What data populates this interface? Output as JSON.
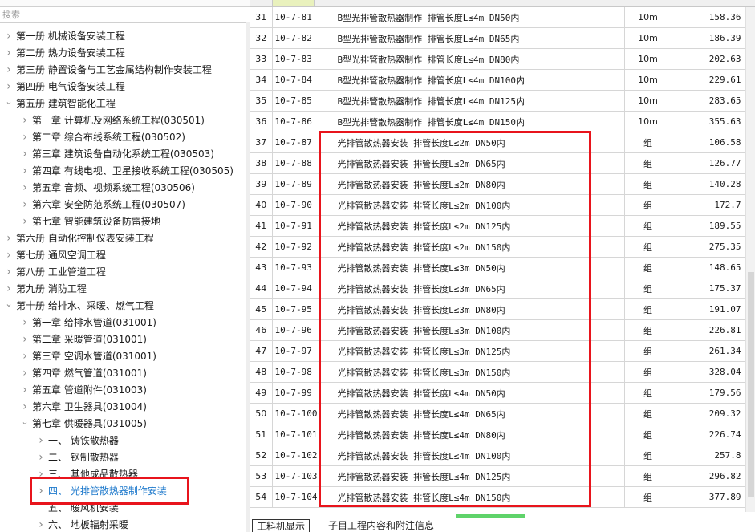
{
  "search_placeholder": "搜索",
  "tree": [
    {
      "level": 0,
      "exp": false,
      "text": "第一册 机械设备安装工程"
    },
    {
      "level": 0,
      "exp": false,
      "text": "第二册 热力设备安装工程"
    },
    {
      "level": 0,
      "exp": false,
      "text": "第三册 静置设备与工艺金属结构制作安装工程"
    },
    {
      "level": 0,
      "exp": false,
      "text": "第四册 电气设备安装工程"
    },
    {
      "level": 0,
      "exp": true,
      "text": "第五册 建筑智能化工程"
    },
    {
      "level": 1,
      "exp": false,
      "text": "第一章 计算机及网络系统工程(030501)"
    },
    {
      "level": 1,
      "exp": false,
      "text": "第二章 综合布线系统工程(030502)"
    },
    {
      "level": 1,
      "exp": false,
      "text": "第三章 建筑设备自动化系统工程(030503)"
    },
    {
      "level": 1,
      "exp": false,
      "text": "第四章 有线电视、卫星接收系统工程(030505)"
    },
    {
      "level": 1,
      "exp": false,
      "text": "第五章 音频、视频系统工程(030506)"
    },
    {
      "level": 1,
      "exp": false,
      "text": "第六章 安全防范系统工程(030507)"
    },
    {
      "level": 1,
      "exp": false,
      "text": "第七章 智能建筑设备防雷接地"
    },
    {
      "level": 0,
      "exp": false,
      "text": "第六册 自动化控制仪表安装工程"
    },
    {
      "level": 0,
      "exp": false,
      "text": "第七册 通风空调工程"
    },
    {
      "level": 0,
      "exp": false,
      "text": "第八册 工业管道工程"
    },
    {
      "level": 0,
      "exp": false,
      "text": "第九册 消防工程"
    },
    {
      "level": 0,
      "exp": true,
      "text": "第十册 给排水、采暖、燃气工程"
    },
    {
      "level": 1,
      "exp": false,
      "text": "第一章 给排水管道(031001)"
    },
    {
      "level": 1,
      "exp": false,
      "text": "第二章 采暖管道(031001)"
    },
    {
      "level": 1,
      "exp": false,
      "text": "第三章 空调水管道(031001)"
    },
    {
      "level": 1,
      "exp": false,
      "text": "第四章 燃气管道(031001)"
    },
    {
      "level": 1,
      "exp": false,
      "text": "第五章 管道附件(031003)"
    },
    {
      "level": 1,
      "exp": false,
      "text": "第六章 卫生器具(031004)"
    },
    {
      "level": 1,
      "exp": true,
      "text": "第七章 供暖器具(031005)"
    },
    {
      "level": 2,
      "exp": false,
      "text": "一、 铸铁散热器"
    },
    {
      "level": 2,
      "exp": false,
      "text": "二、 钢制散热器"
    },
    {
      "level": 2,
      "exp": false,
      "text": "三、 其他成品散热器"
    },
    {
      "level": 2,
      "exp": false,
      "text": "四、 光排管散热器制作安装",
      "selected": true
    },
    {
      "level": 2,
      "exp": null,
      "text": "五、 暖风机安装"
    },
    {
      "level": 2,
      "exp": false,
      "text": "六、 地板辐射采暖"
    }
  ],
  "rows": [
    {
      "no": "31",
      "code": "10-7-81",
      "name": "B型光排管散热器制作 排管长度L≤4m DN50内",
      "unit": "10m",
      "price": "158.36"
    },
    {
      "no": "32",
      "code": "10-7-82",
      "name": "B型光排管散热器制作 排管长度L≤4m DN65内",
      "unit": "10m",
      "price": "186.39"
    },
    {
      "no": "33",
      "code": "10-7-83",
      "name": "B型光排管散热器制作 排管长度L≤4m DN80内",
      "unit": "10m",
      "price": "202.63"
    },
    {
      "no": "34",
      "code": "10-7-84",
      "name": "B型光排管散热器制作 排管长度L≤4m DN100内",
      "unit": "10m",
      "price": "229.61"
    },
    {
      "no": "35",
      "code": "10-7-85",
      "name": "B型光排管散热器制作 排管长度L≤4m DN125内",
      "unit": "10m",
      "price": "283.65"
    },
    {
      "no": "36",
      "code": "10-7-86",
      "name": "B型光排管散热器制作 排管长度L≤4m DN150内",
      "unit": "10m",
      "price": "355.63"
    },
    {
      "no": "37",
      "code": "10-7-87",
      "name": "光排管散热器安装 排管长度L≤2m DN50内",
      "unit": "组",
      "price": "106.58"
    },
    {
      "no": "38",
      "code": "10-7-88",
      "name": "光排管散热器安装 排管长度L≤2m DN65内",
      "unit": "组",
      "price": "126.77"
    },
    {
      "no": "39",
      "code": "10-7-89",
      "name": "光排管散热器安装 排管长度L≤2m DN80内",
      "unit": "组",
      "price": "140.28"
    },
    {
      "no": "40",
      "code": "10-7-90",
      "name": "光排管散热器安装 排管长度L≤2m DN100内",
      "unit": "组",
      "price": "172.7"
    },
    {
      "no": "41",
      "code": "10-7-91",
      "name": "光排管散热器安装 排管长度L≤2m DN125内",
      "unit": "组",
      "price": "189.55"
    },
    {
      "no": "42",
      "code": "10-7-92",
      "name": "光排管散热器安装 排管长度L≤2m DN150内",
      "unit": "组",
      "price": "275.35"
    },
    {
      "no": "43",
      "code": "10-7-93",
      "name": "光排管散热器安装 排管长度L≤3m DN50内",
      "unit": "组",
      "price": "148.65"
    },
    {
      "no": "44",
      "code": "10-7-94",
      "name": "光排管散热器安装 排管长度L≤3m DN65内",
      "unit": "组",
      "price": "175.37"
    },
    {
      "no": "45",
      "code": "10-7-95",
      "name": "光排管散热器安装 排管长度L≤3m DN80内",
      "unit": "组",
      "price": "191.07"
    },
    {
      "no": "46",
      "code": "10-7-96",
      "name": "光排管散热器安装 排管长度L≤3m DN100内",
      "unit": "组",
      "price": "226.81"
    },
    {
      "no": "47",
      "code": "10-7-97",
      "name": "光排管散热器安装 排管长度L≤3m DN125内",
      "unit": "组",
      "price": "261.34"
    },
    {
      "no": "48",
      "code": "10-7-98",
      "name": "光排管散热器安装 排管长度L≤3m DN150内",
      "unit": "组",
      "price": "328.04"
    },
    {
      "no": "49",
      "code": "10-7-99",
      "name": "光排管散热器安装 排管长度L≤4m DN50内",
      "unit": "组",
      "price": "179.56"
    },
    {
      "no": "50",
      "code": "10-7-100",
      "name": "光排管散热器安装 排管长度L≤4m DN65内",
      "unit": "组",
      "price": "209.32"
    },
    {
      "no": "51",
      "code": "10-7-101",
      "name": "光排管散热器安装 排管长度L≤4m DN80内",
      "unit": "组",
      "price": "226.74"
    },
    {
      "no": "52",
      "code": "10-7-102",
      "name": "光排管散热器安装 排管长度L≤4m DN100内",
      "unit": "组",
      "price": "257.8"
    },
    {
      "no": "53",
      "code": "10-7-103",
      "name": "光排管散热器安装 排管长度L≤4m DN125内",
      "unit": "组",
      "price": "296.82"
    },
    {
      "no": "54",
      "code": "10-7-104",
      "name": "光排管散热器安装 排管长度L≤4m DN150内",
      "unit": "组",
      "price": "377.89"
    }
  ],
  "tabs": {
    "active": "工料机显示",
    "inactive": "子目工程内容和附注信息"
  },
  "colors": {
    "highlight": "#e8141c",
    "selected_text": "#1f7acc",
    "header_code_bg": "#e9f1bd",
    "grip": "#5fd36a"
  },
  "icons": {
    "collapsed": "chevron-right-icon",
    "expanded": "chevron-down-icon"
  }
}
